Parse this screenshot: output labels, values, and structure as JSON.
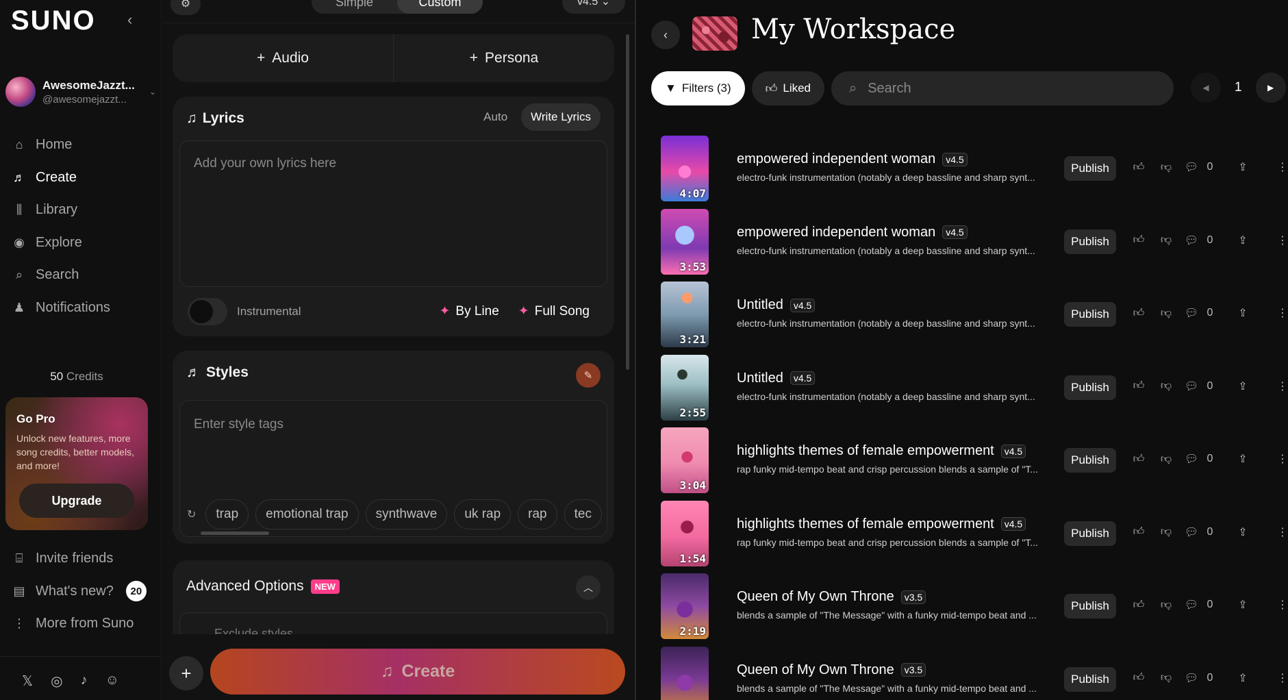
{
  "sidebar": {
    "logo": "SUNO",
    "profile_name": "AwesomeJazzt...",
    "profile_handle": "@awesomejazzt...",
    "nav": [
      {
        "label": "Home",
        "icon": "home-icon"
      },
      {
        "label": "Create",
        "icon": "create-icon"
      },
      {
        "label": "Library",
        "icon": "library-icon"
      },
      {
        "label": "Explore",
        "icon": "explore-icon"
      },
      {
        "label": "Search",
        "icon": "search-icon"
      },
      {
        "label": "Notifications",
        "icon": "bell-icon"
      }
    ],
    "credits_count": "50",
    "credits_label": "Credits",
    "gopro_title": "Go Pro",
    "gopro_text": "Unlock new features, more song credits, better models, and more!",
    "upgrade_label": "Upgrade",
    "nav2": [
      {
        "label": "Invite friends",
        "icon": "gift-icon"
      },
      {
        "label": "What's new?",
        "icon": "news-icon"
      },
      {
        "label": "More from Suno",
        "icon": "more-vertical-icon"
      }
    ],
    "whats_new_count": "20"
  },
  "create": {
    "mode_simple": "Simple",
    "mode_custom": "Custom",
    "version": "v4.5",
    "add_audio": "Audio",
    "add_persona": "Persona",
    "lyrics_title": "Lyrics",
    "lyrics_auto": "Auto",
    "lyrics_write": "Write Lyrics",
    "lyrics_placeholder": "Add your own lyrics here",
    "instrumental_label": "Instrumental",
    "by_line": "By Line",
    "full_song": "Full Song",
    "styles_title": "Styles",
    "styles_placeholder": "Enter style tags",
    "tags": [
      "trap",
      "emotional trap",
      "synthwave",
      "uk rap",
      "rap",
      "tec"
    ],
    "advanced_title": "Advanced Options",
    "new_badge": "NEW",
    "exclude_placeholder": "Exclude styles",
    "create_label": "Create"
  },
  "workspace": {
    "title": "My Workspace",
    "filters_label": "Filters (3)",
    "liked_label": "Liked",
    "search_placeholder": "Search",
    "page": "1",
    "publish_label": "Publish",
    "songs": [
      {
        "title": "empowered independent woman",
        "version": "v4.5",
        "desc": "electro-funk instrumentation (notably a deep bassline and sharp synt...",
        "duration": "4:07",
        "comments": "0"
      },
      {
        "title": "empowered independent woman",
        "version": "v4.5",
        "desc": "electro-funk instrumentation (notably a deep bassline and sharp synt...",
        "duration": "3:53",
        "comments": "0"
      },
      {
        "title": "Untitled",
        "version": "v4.5",
        "desc": "electro-funk instrumentation (notably a deep bassline and sharp synt...",
        "duration": "3:21",
        "comments": "0"
      },
      {
        "title": "Untitled",
        "version": "v4.5",
        "desc": "electro-funk instrumentation (notably a deep bassline and sharp synt...",
        "duration": "2:55",
        "comments": "0"
      },
      {
        "title": "highlights themes of female empowerment",
        "version": "v4.5",
        "desc": "rap funky mid-tempo beat and crisp percussion blends a sample of \"T...",
        "duration": "3:04",
        "comments": "0"
      },
      {
        "title": "highlights themes of female empowerment",
        "version": "v4.5",
        "desc": "rap funky mid-tempo beat and crisp percussion blends a sample of \"T...",
        "duration": "1:54",
        "comments": "0"
      },
      {
        "title": "Queen of My Own Throne",
        "version": "v3.5",
        "desc": "blends a sample of \"The Message\" with a funky mid-tempo beat and ...",
        "duration": "2:19",
        "comments": "0"
      },
      {
        "title": "Queen of My Own Throne",
        "version": "v3.5",
        "desc": "blends a sample of \"The Message\" with a funky mid-tempo beat and ...",
        "duration": "",
        "comments": "0"
      }
    ]
  }
}
